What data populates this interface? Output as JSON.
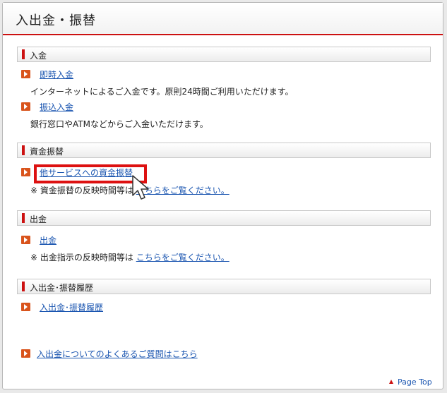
{
  "page": {
    "title": "入出金・振替"
  },
  "sections": {
    "deposit": {
      "title": "入金",
      "items": [
        {
          "link": "即時入金",
          "desc": "インターネットによるご入金です。原則24時間ご利用いただけます。"
        },
        {
          "link": "振込入金",
          "desc": "銀行窓口やATMなどからご入金いただけます。"
        }
      ]
    },
    "transfer": {
      "title": "資金振替",
      "link": "他サービスへの資金振替",
      "note_prefix": "※ 資金振替の反映時間等は",
      "note_link": "こちらをご覧ください。"
    },
    "withdrawal": {
      "title": "出金",
      "link": "出金",
      "note_prefix": "※ 出金指示の反映時間等は",
      "note_link": "こちらをご覧ください。"
    },
    "history": {
      "title": "入出金･振替履歴",
      "link": "入出金･振替履歴"
    }
  },
  "faq_link": "入出金についてのよくあるご質問はこちら",
  "page_top": "Page Top",
  "colors": {
    "accent": "#cc1111",
    "link": "#1a55b0",
    "arrow": "#d9541c"
  }
}
